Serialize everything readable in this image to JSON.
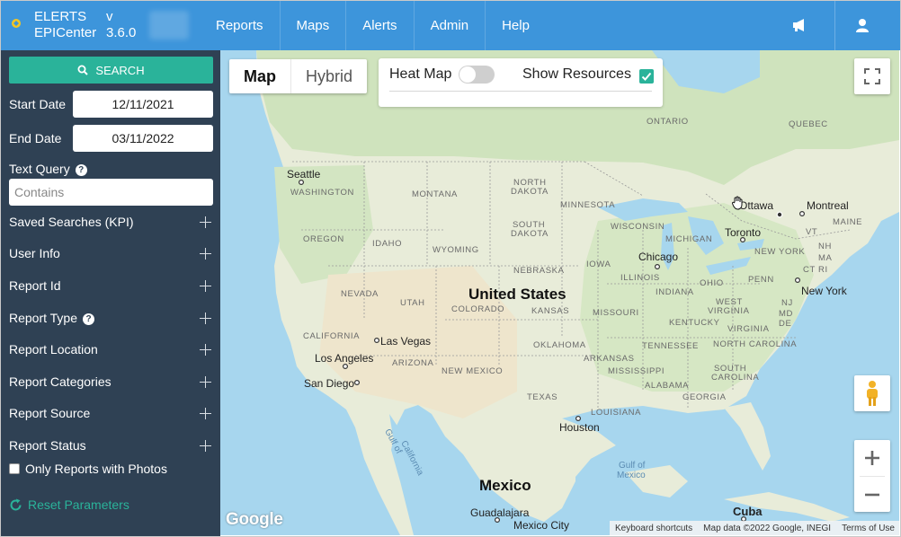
{
  "header": {
    "app_title_line1": "ELERTS",
    "app_title_line2": "EPICenter",
    "version_line1": "v",
    "version_line2": "3.6.0",
    "nav": [
      "Reports",
      "Maps",
      "Alerts",
      "Admin",
      "Help"
    ]
  },
  "sidebar": {
    "search_label": "SEARCH",
    "start_date_label": "Start Date",
    "start_date_value": "12/11/2021",
    "end_date_label": "End Date",
    "end_date_value": "03/11/2022",
    "text_query_label": "Text Query",
    "text_query_placeholder": "Contains",
    "sections": [
      "Saved Searches (KPI)",
      "User Info",
      "Report Id",
      "Report Type",
      "Report Location",
      "Report Categories",
      "Report Source",
      "Report Status"
    ],
    "only_photos_label": "Only Reports with Photos",
    "reset_label": "Reset Parameters"
  },
  "map": {
    "map_type_map": "Map",
    "map_type_hybrid": "Hybrid",
    "heat_map_label": "Heat Map",
    "heat_map_on": false,
    "show_resources_label": "Show Resources",
    "show_resources_checked": true,
    "country_label": "United States",
    "mexico_label": "Mexico",
    "cuba_label": "Cuba",
    "cities": {
      "seattle": "Seattle",
      "las_vegas": "Las Vegas",
      "los_angeles": "Los Angeles",
      "san_diego": "San Diego",
      "chicago": "Chicago",
      "toronto": "Toronto",
      "ottawa": "Ottawa",
      "montreal": "Montreal",
      "new_york": "New York",
      "houston": "Houston",
      "guadalajara": "Guadalajara",
      "mexico_city": "Mexico City"
    },
    "regions": {
      "ontario": "ONTARIO",
      "quebec": "QUEBEC",
      "washington": "WASHINGTON",
      "montana": "MONTANA",
      "north_dakota_1": "NORTH",
      "north_dakota_2": "DAKOTA",
      "minnesota": "MINNESOTA",
      "south_dakota_1": "SOUTH",
      "south_dakota_2": "DAKOTA",
      "oregon": "OREGON",
      "idaho": "IDAHO",
      "wyoming": "WYOMING",
      "wisconsin": "WISCONSIN",
      "michigan": "MICHIGAN",
      "maine": "MAINE",
      "vt": "VT",
      "nh": "NH",
      "ma": "MA",
      "ri": "RI",
      "ct": "CT",
      "new_york_state": "NEW YORK",
      "nebraska": "NEBRASKA",
      "iowa": "IOWA",
      "illinois": "ILLINOIS",
      "indiana": "INDIANA",
      "ohio": "OHIO",
      "penn": "PENN",
      "nevada": "NEVADA",
      "utah": "UTAH",
      "colorado": "COLORADO",
      "kansas": "KANSAS",
      "missouri": "MISSOURI",
      "kentucky": "KENTUCKY",
      "west_virginia_1": "WEST",
      "west_virginia_2": "VIRGINIA",
      "virginia": "VIRGINIA",
      "nj": "NJ",
      "md": "MD",
      "de": "DE",
      "california": "CALIFORNIA",
      "arizona": "ARIZONA",
      "new_mexico": "NEW MEXICO",
      "oklahoma": "OKLAHOMA",
      "tennessee": "TENNESSEE",
      "north_carolina": "NORTH CAROLINA",
      "arkansas": "ARKANSAS",
      "south_carolina_1": "SOUTH",
      "south_carolina_2": "CAROLINA",
      "mississippi": "MISSISSIPPI",
      "alabama": "ALABAMA",
      "georgia": "GEORGIA",
      "texas": "TEXAS",
      "louisiana": "LOUISIANA",
      "gulf_california_1": "Gulf of",
      "gulf_california_2": "California",
      "gulf_mexico_1": "Gulf of",
      "gulf_mexico_2": "Mexico"
    },
    "google_logo": "Google",
    "attribution": {
      "shortcuts": "Keyboard shortcuts",
      "map_data": "Map data ©2022 Google, INEGI",
      "terms": "Terms of Use"
    },
    "colors": {
      "land": "#e8ecd9",
      "land_green": "#cfe3bd",
      "desert": "#efe6cf",
      "water": "#a7d6ee",
      "border": "#8d8d8d"
    }
  },
  "colors": {
    "topbar": "#3d95db",
    "sidebar": "#2f4154",
    "accent": "#2ab39a"
  }
}
